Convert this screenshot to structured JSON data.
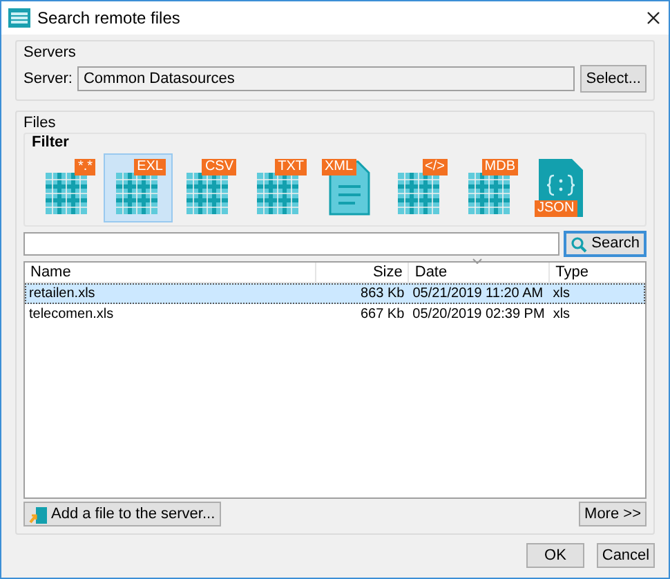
{
  "window": {
    "title": "Search remote files"
  },
  "servers": {
    "group_label": "Servers",
    "field_label": "Server:",
    "value": "Common Datasources",
    "button": "Select..."
  },
  "files": {
    "group_label": "Files",
    "filter_label": "Filter",
    "filters": [
      {
        "kind": "grid",
        "badge": "*.*",
        "selected": false
      },
      {
        "kind": "grid",
        "badge": "EXL",
        "selected": true
      },
      {
        "kind": "grid",
        "badge": "CSV",
        "selected": false
      },
      {
        "kind": "grid",
        "badge": "TXT",
        "selected": false
      },
      {
        "kind": "doc",
        "badge": "XML",
        "selected": false
      },
      {
        "kind": "grid",
        "badge": "</>",
        "selected": false
      },
      {
        "kind": "grid",
        "badge": "MDB",
        "selected": false
      },
      {
        "kind": "json",
        "badge": "JSON",
        "selected": false
      }
    ],
    "search_button": "Search",
    "table": {
      "columns": [
        "Name",
        "Size",
        "Date",
        "Type"
      ],
      "rows": [
        {
          "cells": [
            "retailen.xls",
            "863 Kb",
            "05/21/2019 11:20 AM",
            "xls"
          ],
          "selected": true
        },
        {
          "cells": [
            "telecomen.xls",
            "667 Kb",
            "05/20/2019 02:39 PM",
            "xls"
          ],
          "selected": false
        }
      ]
    },
    "add_button": "Add a file to the server...",
    "more_button": "More >>"
  },
  "buttons": [
    "OK",
    "Cancel"
  ]
}
